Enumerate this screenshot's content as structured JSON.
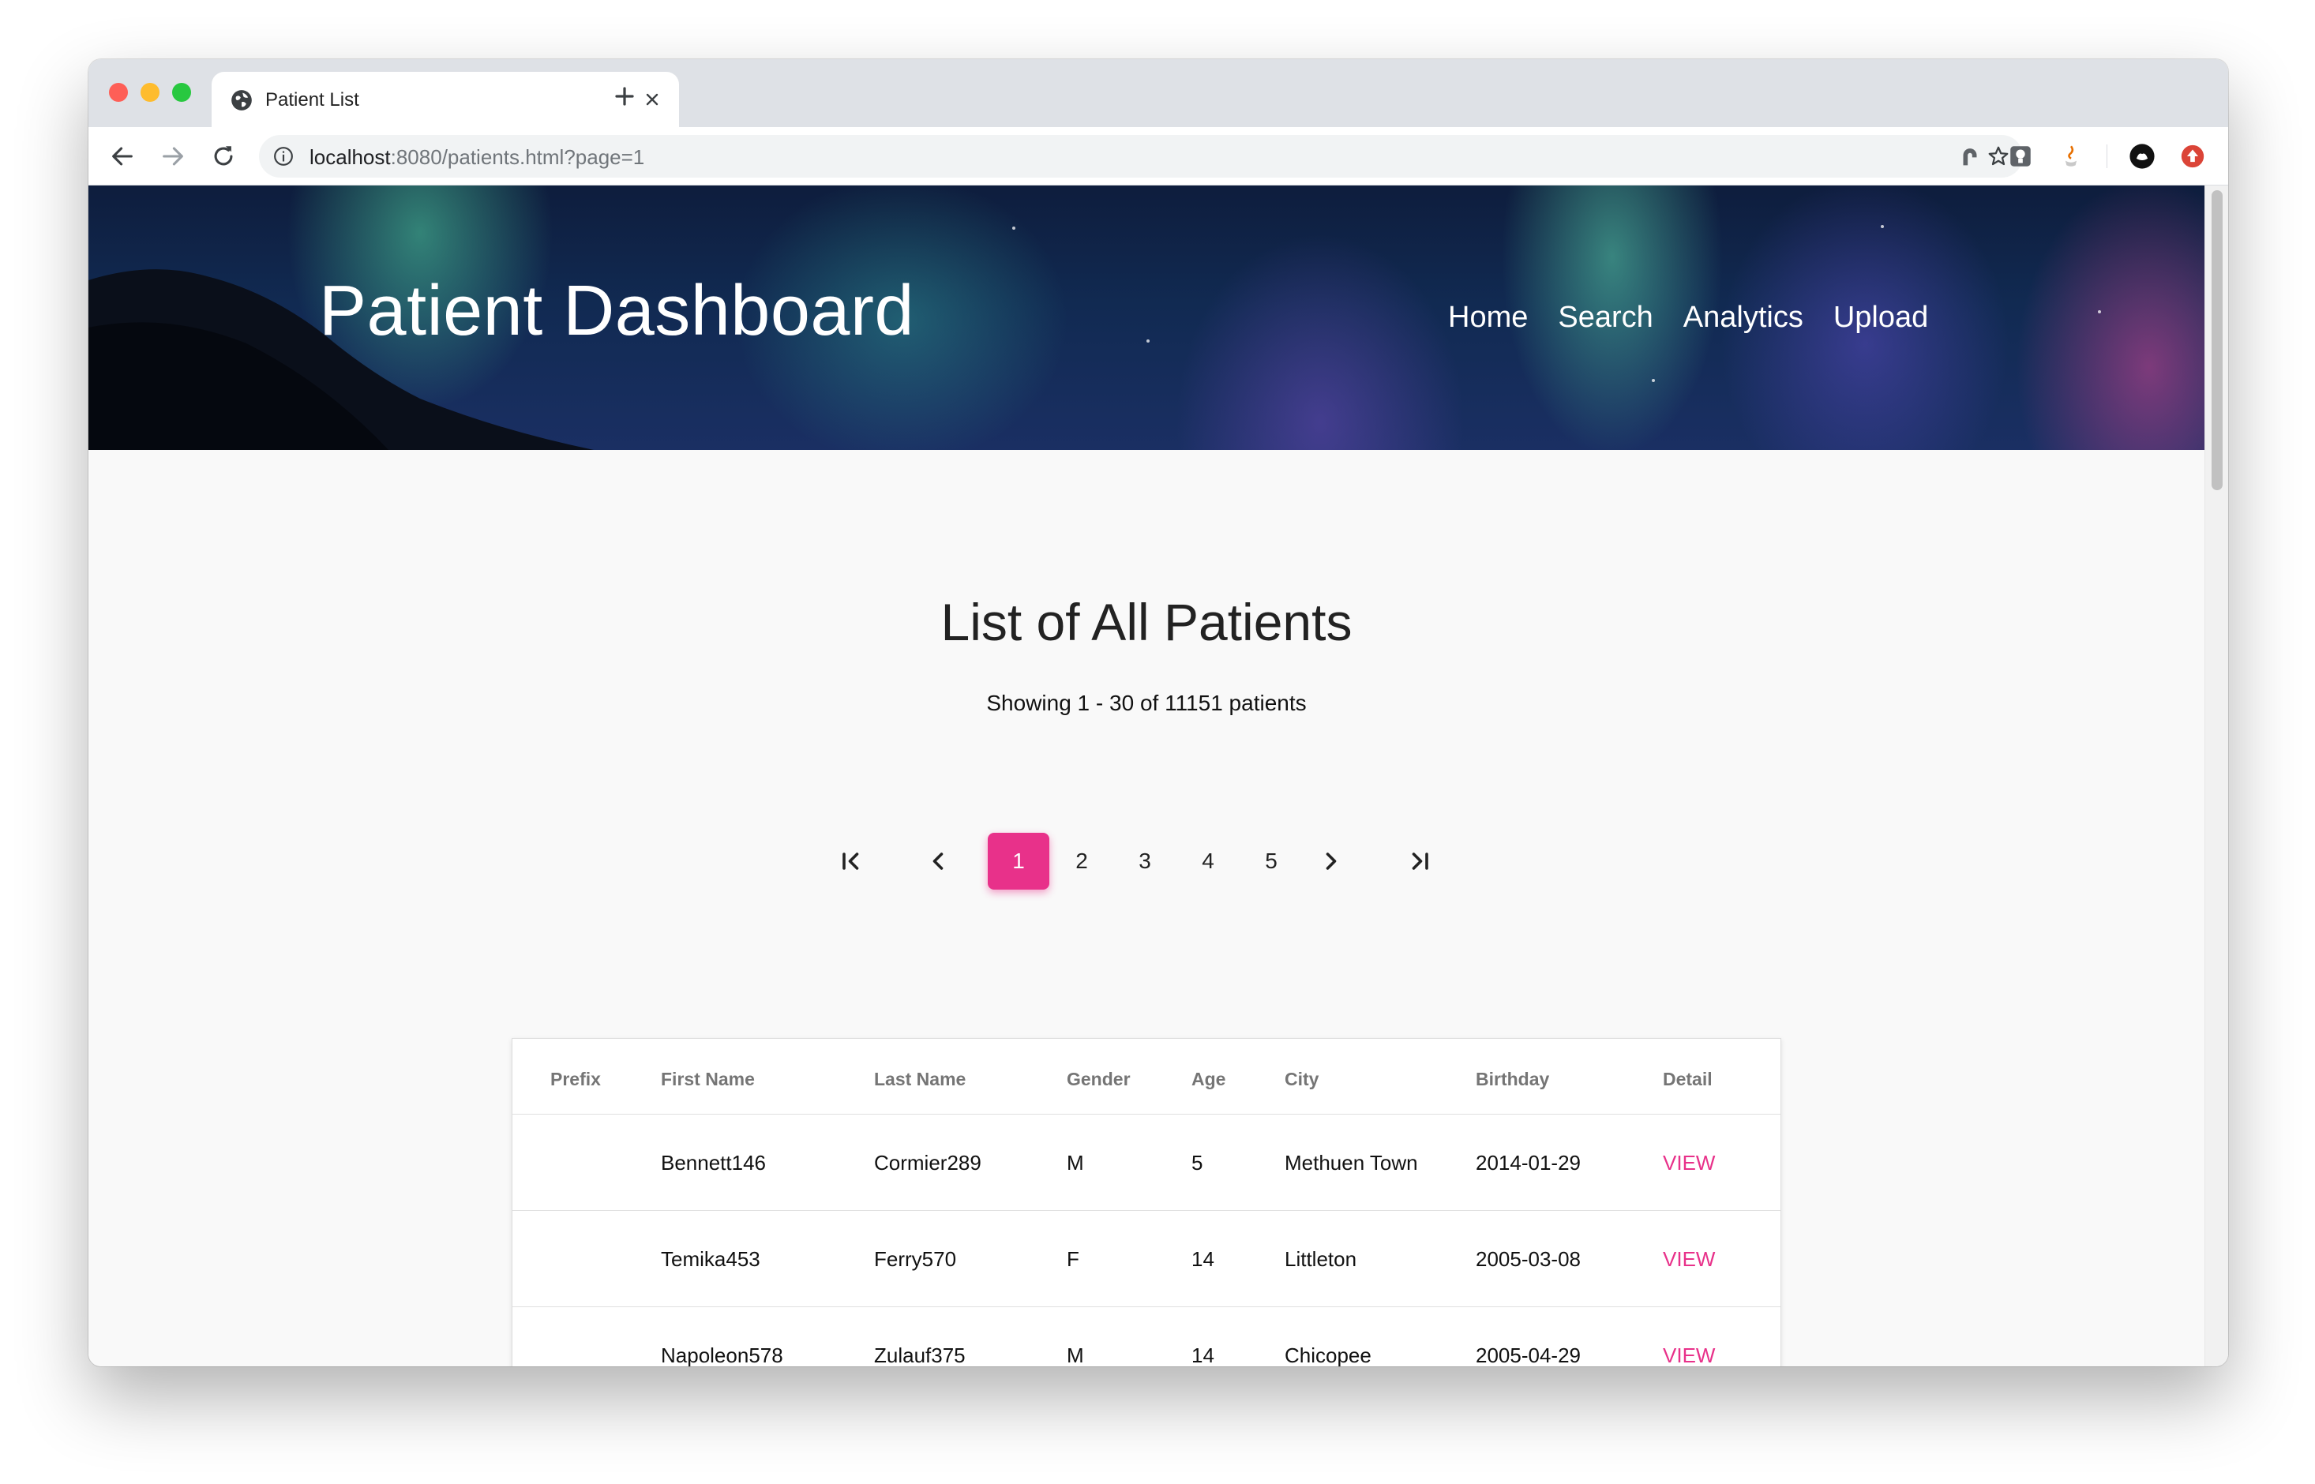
{
  "browser": {
    "tab_title": "Patient List",
    "url_host": "localhost",
    "url_rest": ":8080/patients.html?page=1"
  },
  "header": {
    "title": "Patient Dashboard",
    "nav": [
      "Home",
      "Search",
      "Analytics",
      "Upload"
    ]
  },
  "main": {
    "title": "List of All Patients",
    "summary": "Showing 1 - 30 of 11151 patients"
  },
  "pagination": {
    "pages": [
      "1",
      "2",
      "3",
      "4",
      "5"
    ],
    "current": "1",
    "accent_color": "#e8318a"
  },
  "table": {
    "columns": [
      "Prefix",
      "First Name",
      "Last Name",
      "Gender",
      "Age",
      "City",
      "Birthday",
      "Detail"
    ],
    "rows": [
      {
        "prefix": "",
        "first_name": "Bennett146",
        "last_name": "Cormier289",
        "gender": "M",
        "age": "5",
        "city": "Methuen Town",
        "birthday": "2014-01-29",
        "detail": "VIEW"
      },
      {
        "prefix": "",
        "first_name": "Temika453",
        "last_name": "Ferry570",
        "gender": "F",
        "age": "14",
        "city": "Littleton",
        "birthday": "2005-03-08",
        "detail": "VIEW"
      },
      {
        "prefix": "",
        "first_name": "Napoleon578",
        "last_name": "Zulauf375",
        "gender": "M",
        "age": "14",
        "city": "Chicopee",
        "birthday": "2005-04-29",
        "detail": "VIEW"
      }
    ]
  }
}
